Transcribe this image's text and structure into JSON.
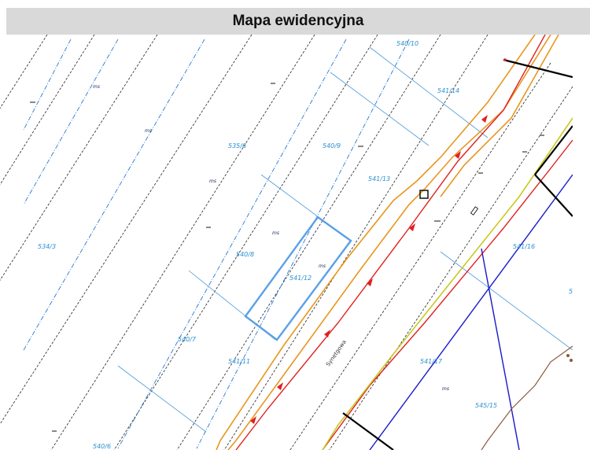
{
  "header": {
    "title": "Mapa ewidencyjna"
  },
  "map": {
    "street_name": "Synetgowa",
    "parcels": [
      "540/10",
      "541/14",
      "535/6",
      "540/9",
      "541/13",
      "534/3",
      "540/8",
      "541/12",
      "541/16",
      "540/7",
      "541/11",
      "541/17",
      "545/15",
      "540/6",
      "5"
    ],
    "land_use_markers": [
      "ms",
      "ms",
      "ms",
      "ms",
      "ms",
      "ms"
    ],
    "colors": {
      "parcel_boundary": "#4a9ad8",
      "selected_parcel": "#5aa0e8",
      "orange_line": "#e8961e",
      "red_line": "#e02020",
      "yellow_line": "#c8c820",
      "blue_line": "#1a1acc",
      "black_line": "#000000",
      "brown_line": "#8b5a3c"
    }
  }
}
